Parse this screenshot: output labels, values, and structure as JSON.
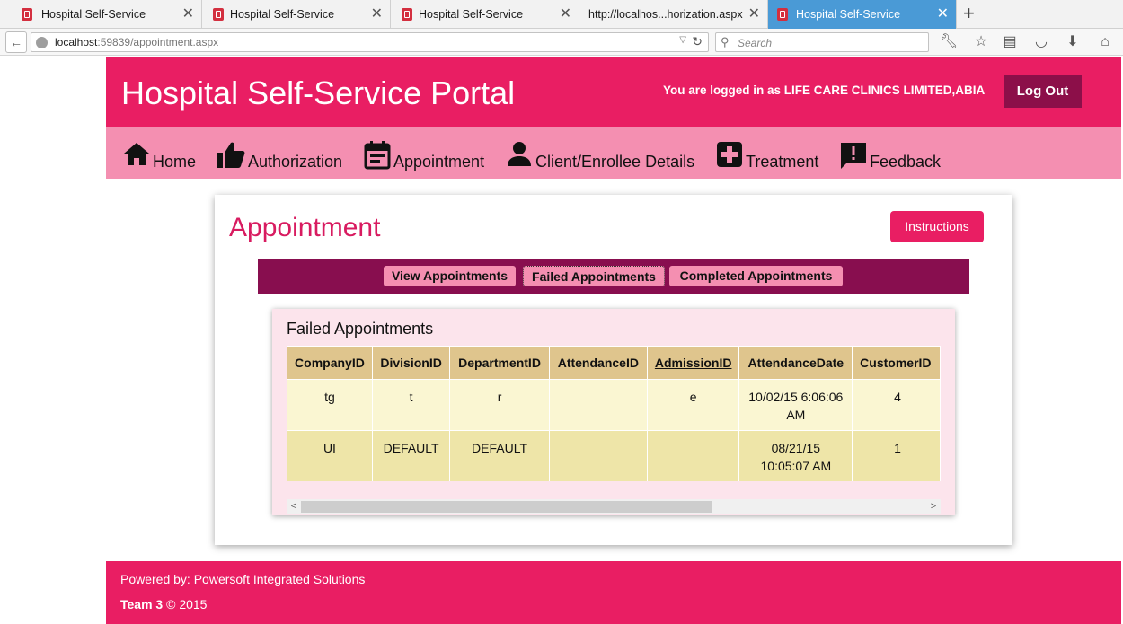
{
  "browser": {
    "tabs": [
      {
        "title": "Hospital Self-Service",
        "active": false,
        "favicon": "hospital-favicon"
      },
      {
        "title": "Hospital Self-Service",
        "active": false,
        "favicon": "hospital-favicon"
      },
      {
        "title": "Hospital Self-Service",
        "active": false,
        "favicon": "hospital-favicon"
      },
      {
        "title": "http://localhos...horization.aspx",
        "active": false,
        "favicon": ""
      },
      {
        "title": "Hospital Self-Service",
        "active": true,
        "favicon": "hospital-favicon"
      }
    ],
    "new_tab_label": "+",
    "url_host": "localhost",
    "url_rest": ":59839/appointment.aspx",
    "search_placeholder": "Search"
  },
  "header": {
    "title": "Hospital Self-Service Portal",
    "logged_in_text": "You are logged in as LIFE CARE CLINICS LIMITED,ABIA",
    "logout_label": "Log Out"
  },
  "nav": {
    "items": [
      {
        "label": "Home",
        "icon": "home-icon"
      },
      {
        "label": "Authorization",
        "icon": "thumbs-up-icon"
      },
      {
        "label": "Appointment",
        "icon": "calendar-icon"
      },
      {
        "label": "Client/Enrollee Details",
        "icon": "person-icon"
      },
      {
        "label": "Treatment",
        "icon": "medical-cross-icon"
      },
      {
        "label": "Feedback",
        "icon": "feedback-icon"
      }
    ]
  },
  "main": {
    "page_title": "Appointment",
    "instructions_label": "Instructions",
    "tabs": [
      {
        "label": "View Appointments",
        "selected": false
      },
      {
        "label": "Failed Appointments",
        "selected": true
      },
      {
        "label": "Completed Appointments",
        "selected": false
      }
    ],
    "panel_title": "Failed Appointments",
    "table": {
      "columns": [
        "CompanyID",
        "DivisionID",
        "DepartmentID",
        "AttendanceID",
        "AdmissionID",
        "AttendanceDate",
        "CustomerID"
      ],
      "rows": [
        [
          "tg",
          "t",
          "r",
          "",
          "e",
          "10/02/15 6:06:06 AM",
          "4"
        ],
        [
          "UI",
          "DEFAULT",
          "DEFAULT",
          "",
          "",
          "08/21/15 10:05:07 AM",
          "1"
        ]
      ]
    }
  },
  "footer": {
    "powered_by": "Powered by: Powersoft Integrated Solutions",
    "team_name": "Team 3",
    "copyright": "© 2015"
  },
  "colors": {
    "brand": "#e91e63",
    "nav_bg": "#f48fb1",
    "dark_accent": "#880e4f",
    "table_header": "#dfc58d",
    "row_odd": "#faf6d2",
    "row_even": "#eee5a8"
  }
}
